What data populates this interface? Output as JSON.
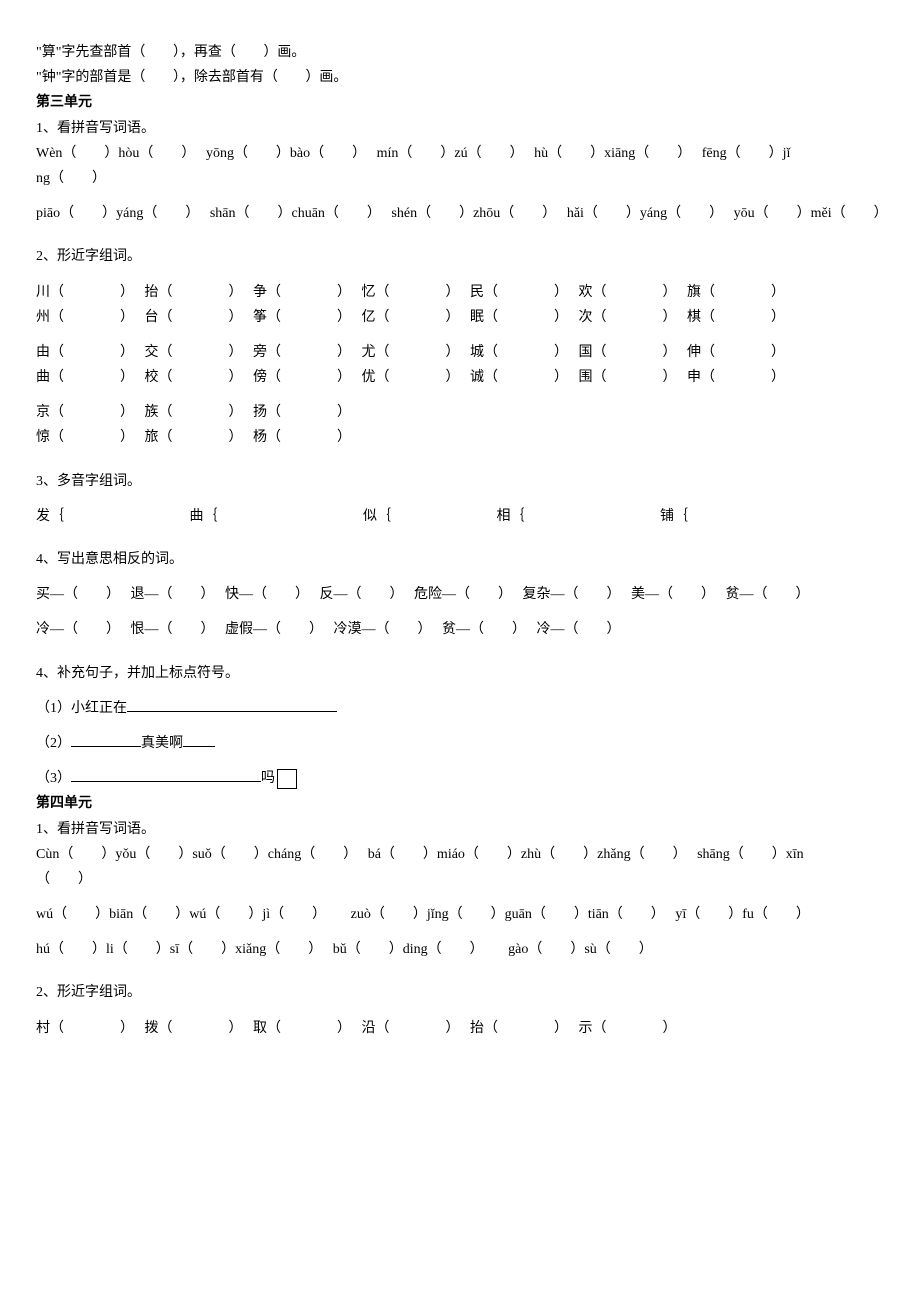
{
  "intro": {
    "line1a": "\"算\"字先查部首（",
    "line1b": "），再查（",
    "line1c": "）画。",
    "line2a": "\"钟\"字的部首是（",
    "line2b": "），除去部首有（",
    "line2c": "）画。"
  },
  "unit3": {
    "title": "第三单元",
    "q1": "1、看拼音写词语。",
    "pinyin1": [
      "Wèn（　　）hòu（　　）",
      "yōng（　　）bào（　　）",
      "mín（　　）zú（　　）",
      "hù（　　）xiāng（　　）",
      "fēng（　　）jǐ"
    ],
    "pinyin1b": "ng（　　）",
    "pinyin2": [
      "piāo（　　）yáng（　　）",
      "shān（　　）chuān（　　）",
      "shén（　　）zhōu（　　）",
      "hǎi（　　）yáng（　　）",
      "yōu（　　）měi（　　）"
    ],
    "q2": "2、形近字组词。",
    "pairRow1": [
      "川（　　　　）",
      "抬（　　　　）",
      "争（　　　　）",
      "忆（　　　　）",
      "民（　　　　）",
      "欢（　　　　）",
      "旗（　　　　）"
    ],
    "pairRow2": [
      "州（　　　　）",
      "台（　　　　）",
      "筝（　　　　）",
      "亿（　　　　）",
      "眠（　　　　）",
      "次（　　　　）",
      "棋（　　　　）"
    ],
    "pairRow3": [
      "由（　　　　）",
      "交（　　　　）",
      "旁（　　　　）",
      "尤（　　　　）",
      "城（　　　　）",
      "国（　　　　）",
      "伸（　　　　）"
    ],
    "pairRow4": [
      "曲（　　　　）",
      "校（　　　　）",
      "傍（　　　　）",
      "优（　　　　）",
      "诚（　　　　）",
      "围（　　　　）",
      "申（　　　　）"
    ],
    "pairRow5": [
      "京（　　　　）",
      "族（　　　　）",
      "扬（　　　　）"
    ],
    "pairRow6": [
      "惊（　　　　）",
      "旅（　　　　）",
      "杨（　　　　）"
    ],
    "q3": "3、多音字组词。",
    "poly": [
      "发｛",
      "曲｛",
      "似｛",
      "相｛",
      "铺｛"
    ],
    "q4": "4、写出意思相反的词。",
    "ant1": [
      "买—（　　）",
      "退—（　　）",
      "快—（　　）",
      "反—（　　）",
      "危险—（　　）",
      "复杂—（　　）",
      "美—（　　）",
      "贫—（　　）"
    ],
    "ant2": [
      "冷—（　　）",
      "恨—（　　）",
      "虚假—（　　）",
      "冷漠—（　　）",
      "贫—（　　）",
      "冷—（　　）"
    ],
    "q5": "4、补充句子，并加上标点符号。",
    "sent1a": "（1）小红正在",
    "sent2a": "（2）",
    "sent2b": "真美啊",
    "sent3a": "（3）",
    "sent3b": "吗"
  },
  "unit4": {
    "title": "第四单元",
    "q1": "1、看拼音写词语。",
    "pinyin1": [
      "Cùn（　　）yǒu（　　）suǒ（　　）cháng（　　）",
      "bá（　　）miáo（　　）zhù（　　）zhǎng（　　）",
      "shāng（　　）xīn"
    ],
    "pinyin1b": "（　　）",
    "pinyin2": [
      "wú（　　）biān（　　）wú（　　）jì（　　）",
      "zuò（　　）jǐng（　　）guān（　　）tiān（　　）",
      "yī（　　）fu（　　）"
    ],
    "pinyin3": [
      "hú（　　）li（　　）sī（　　）xiǎng（　　）",
      "bǔ（　　）ding（　　）",
      "gào（　　）sù（　　）"
    ],
    "q2": "2、形近字组词。",
    "pairRow1": [
      "村（　　　　）",
      "拨（　　　　）",
      "取（　　　　）",
      "沿（　　　　）",
      "抬（　　　　）",
      "示（　　　　）"
    ]
  }
}
